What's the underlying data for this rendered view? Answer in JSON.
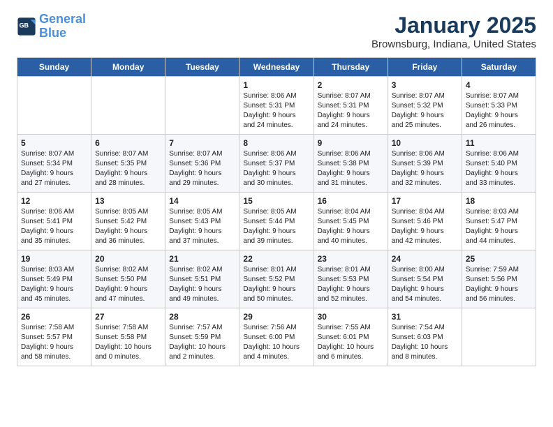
{
  "header": {
    "logo_line1": "General",
    "logo_line2": "Blue",
    "title": "January 2025",
    "subtitle": "Brownsburg, Indiana, United States"
  },
  "weekdays": [
    "Sunday",
    "Monday",
    "Tuesday",
    "Wednesday",
    "Thursday",
    "Friday",
    "Saturday"
  ],
  "weeks": [
    [
      {
        "day": "",
        "text": ""
      },
      {
        "day": "",
        "text": ""
      },
      {
        "day": "",
        "text": ""
      },
      {
        "day": "1",
        "text": "Sunrise: 8:06 AM\nSunset: 5:31 PM\nDaylight: 9 hours\nand 24 minutes."
      },
      {
        "day": "2",
        "text": "Sunrise: 8:07 AM\nSunset: 5:31 PM\nDaylight: 9 hours\nand 24 minutes."
      },
      {
        "day": "3",
        "text": "Sunrise: 8:07 AM\nSunset: 5:32 PM\nDaylight: 9 hours\nand 25 minutes."
      },
      {
        "day": "4",
        "text": "Sunrise: 8:07 AM\nSunset: 5:33 PM\nDaylight: 9 hours\nand 26 minutes."
      }
    ],
    [
      {
        "day": "5",
        "text": "Sunrise: 8:07 AM\nSunset: 5:34 PM\nDaylight: 9 hours\nand 27 minutes."
      },
      {
        "day": "6",
        "text": "Sunrise: 8:07 AM\nSunset: 5:35 PM\nDaylight: 9 hours\nand 28 minutes."
      },
      {
        "day": "7",
        "text": "Sunrise: 8:07 AM\nSunset: 5:36 PM\nDaylight: 9 hours\nand 29 minutes."
      },
      {
        "day": "8",
        "text": "Sunrise: 8:06 AM\nSunset: 5:37 PM\nDaylight: 9 hours\nand 30 minutes."
      },
      {
        "day": "9",
        "text": "Sunrise: 8:06 AM\nSunset: 5:38 PM\nDaylight: 9 hours\nand 31 minutes."
      },
      {
        "day": "10",
        "text": "Sunrise: 8:06 AM\nSunset: 5:39 PM\nDaylight: 9 hours\nand 32 minutes."
      },
      {
        "day": "11",
        "text": "Sunrise: 8:06 AM\nSunset: 5:40 PM\nDaylight: 9 hours\nand 33 minutes."
      }
    ],
    [
      {
        "day": "12",
        "text": "Sunrise: 8:06 AM\nSunset: 5:41 PM\nDaylight: 9 hours\nand 35 minutes."
      },
      {
        "day": "13",
        "text": "Sunrise: 8:05 AM\nSunset: 5:42 PM\nDaylight: 9 hours\nand 36 minutes."
      },
      {
        "day": "14",
        "text": "Sunrise: 8:05 AM\nSunset: 5:43 PM\nDaylight: 9 hours\nand 37 minutes."
      },
      {
        "day": "15",
        "text": "Sunrise: 8:05 AM\nSunset: 5:44 PM\nDaylight: 9 hours\nand 39 minutes."
      },
      {
        "day": "16",
        "text": "Sunrise: 8:04 AM\nSunset: 5:45 PM\nDaylight: 9 hours\nand 40 minutes."
      },
      {
        "day": "17",
        "text": "Sunrise: 8:04 AM\nSunset: 5:46 PM\nDaylight: 9 hours\nand 42 minutes."
      },
      {
        "day": "18",
        "text": "Sunrise: 8:03 AM\nSunset: 5:47 PM\nDaylight: 9 hours\nand 44 minutes."
      }
    ],
    [
      {
        "day": "19",
        "text": "Sunrise: 8:03 AM\nSunset: 5:49 PM\nDaylight: 9 hours\nand 45 minutes."
      },
      {
        "day": "20",
        "text": "Sunrise: 8:02 AM\nSunset: 5:50 PM\nDaylight: 9 hours\nand 47 minutes."
      },
      {
        "day": "21",
        "text": "Sunrise: 8:02 AM\nSunset: 5:51 PM\nDaylight: 9 hours\nand 49 minutes."
      },
      {
        "day": "22",
        "text": "Sunrise: 8:01 AM\nSunset: 5:52 PM\nDaylight: 9 hours\nand 50 minutes."
      },
      {
        "day": "23",
        "text": "Sunrise: 8:01 AM\nSunset: 5:53 PM\nDaylight: 9 hours\nand 52 minutes."
      },
      {
        "day": "24",
        "text": "Sunrise: 8:00 AM\nSunset: 5:54 PM\nDaylight: 9 hours\nand 54 minutes."
      },
      {
        "day": "25",
        "text": "Sunrise: 7:59 AM\nSunset: 5:56 PM\nDaylight: 9 hours\nand 56 minutes."
      }
    ],
    [
      {
        "day": "26",
        "text": "Sunrise: 7:58 AM\nSunset: 5:57 PM\nDaylight: 9 hours\nand 58 minutes."
      },
      {
        "day": "27",
        "text": "Sunrise: 7:58 AM\nSunset: 5:58 PM\nDaylight: 10 hours\nand 0 minutes."
      },
      {
        "day": "28",
        "text": "Sunrise: 7:57 AM\nSunset: 5:59 PM\nDaylight: 10 hours\nand 2 minutes."
      },
      {
        "day": "29",
        "text": "Sunrise: 7:56 AM\nSunset: 6:00 PM\nDaylight: 10 hours\nand 4 minutes."
      },
      {
        "day": "30",
        "text": "Sunrise: 7:55 AM\nSunset: 6:01 PM\nDaylight: 10 hours\nand 6 minutes."
      },
      {
        "day": "31",
        "text": "Sunrise: 7:54 AM\nSunset: 6:03 PM\nDaylight: 10 hours\nand 8 minutes."
      },
      {
        "day": "",
        "text": ""
      }
    ]
  ]
}
